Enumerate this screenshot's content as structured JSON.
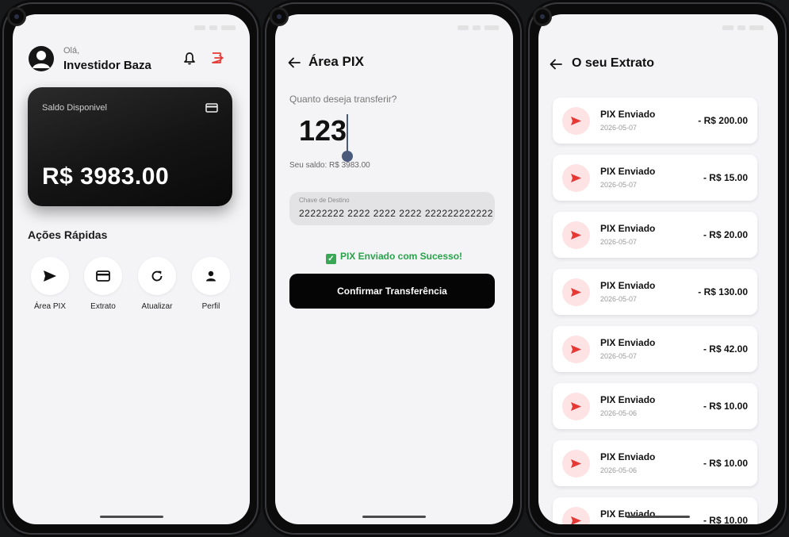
{
  "colors": {
    "accent_red": "#e53935",
    "success_green": "#27a34a",
    "card_black": "#111111"
  },
  "home": {
    "greeting": "Olá,",
    "user_name": "Investidor Baza",
    "card_label": "Saldo Disponivel",
    "balance": "R$ 3983.00",
    "quick_actions_title": "Ações Rápidas",
    "actions": [
      {
        "label": "Área PIX",
        "icon": "send-icon"
      },
      {
        "label": "Extrato",
        "icon": "credit-card-icon"
      },
      {
        "label": "Atualizar",
        "icon": "refresh-icon"
      },
      {
        "label": "Perfil",
        "icon": "person-icon"
      }
    ]
  },
  "pix": {
    "title": "Área PIX",
    "question": "Quanto deseja transferir?",
    "amount_value": "123",
    "balance_note": "Seu saldo: R$ 3983.00",
    "key_label": "Chave de Destino",
    "key_value": "22222222 2222 2222 2222 222222222222",
    "success_message": "PIX Enviado com Sucesso!",
    "confirm_label": "Confirmar Transferência"
  },
  "statement": {
    "title": "O seu Extrato",
    "transactions": [
      {
        "title": "PIX Enviado",
        "date": "2026-05-07",
        "amount": "- R$ 200.00"
      },
      {
        "title": "PIX Enviado",
        "date": "2026-05-07",
        "amount": "- R$ 15.00"
      },
      {
        "title": "PIX Enviado",
        "date": "2026-05-07",
        "amount": "- R$ 20.00"
      },
      {
        "title": "PIX Enviado",
        "date": "2026-05-07",
        "amount": "- R$ 130.00"
      },
      {
        "title": "PIX Enviado",
        "date": "2026-05-07",
        "amount": "- R$ 42.00"
      },
      {
        "title": "PIX Enviado",
        "date": "2026-05-06",
        "amount": "- R$ 10.00"
      },
      {
        "title": "PIX Enviado",
        "date": "2026-05-06",
        "amount": "- R$ 10.00"
      },
      {
        "title": "PIX Enviado",
        "date": "",
        "amount": "- R$ 10.00"
      }
    ]
  }
}
